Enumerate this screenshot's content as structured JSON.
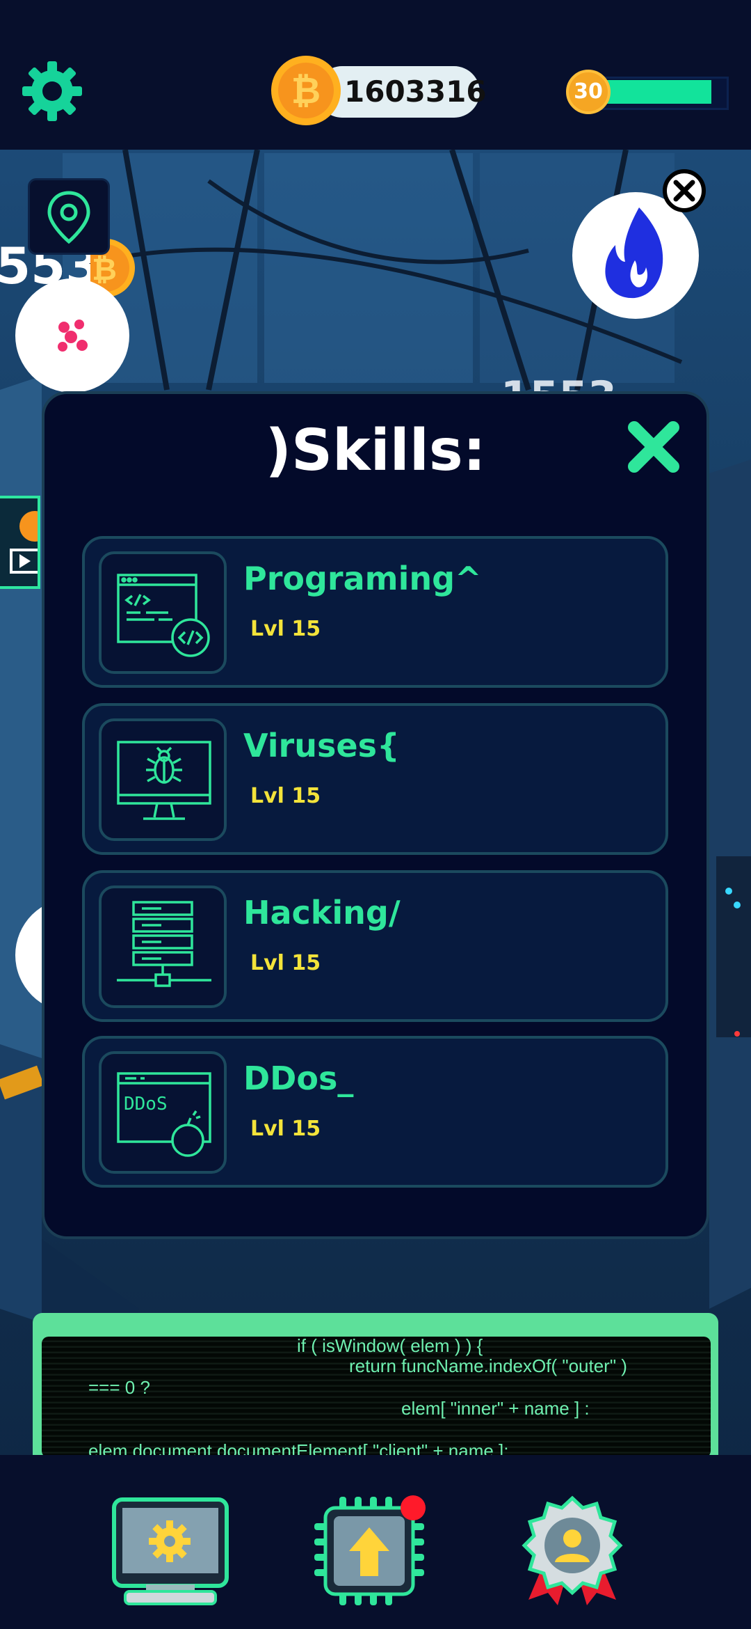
{
  "header": {
    "coin_balance": "1603316",
    "player_level": "30",
    "level_progress": 0.9
  },
  "left_panel": {
    "earnings_partial": "553"
  },
  "right_panel": {
    "earnings_partial": "1553"
  },
  "skills_dialog": {
    "title": ")Skills:",
    "items": [
      {
        "name": "Programing^",
        "level": "Lvl 15",
        "icon": "code-window-icon"
      },
      {
        "name": "Viruses{",
        "level": "Lvl 15",
        "icon": "bug-monitor-icon"
      },
      {
        "name": "Hacking/",
        "level": "Lvl 15",
        "icon": "server-network-icon"
      },
      {
        "name": "DDos_",
        "level": "Lvl 15",
        "icon": "ddos-bomb-icon"
      }
    ],
    "ddos_icon_text": "DDoS"
  },
  "terminal": {
    "lines": [
      "if ( isWindow( elem ) ) {",
      "return funcName.indexOf( \"outer\" )",
      "=== 0 ?",
      "elem[ \"inner\" + name ] :",
      "elem.document.documentElement[ \"client\" + name ];"
    ]
  },
  "bottom_nav": {
    "items": [
      "computer-settings-icon",
      "upgrade-chip-icon",
      "profile-badge-icon"
    ],
    "upgrade_has_notification": true
  },
  "colors": {
    "accent_green": "#2fe69b",
    "level_yellow": "#f3e33a",
    "panel_bg": "#030a2a",
    "card_bg": "#071a3e",
    "coin_orange": "#f5a623"
  }
}
